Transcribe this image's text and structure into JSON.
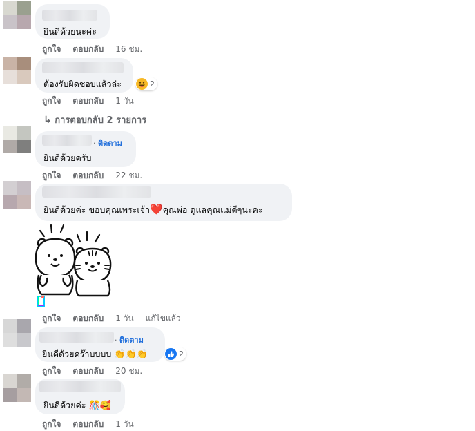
{
  "comments": [
    {
      "text": "ยินดีด้วยนะค่ะ",
      "like": "ถูกใจ",
      "reply": "ตอบกลับ",
      "time": "16 ชม.",
      "avatar_colors": [
        "#d8d8d0",
        "#9aa08f",
        "#c9c3c8",
        "#b8a8ae"
      ]
    },
    {
      "text": "ต้องรับผิดชอบแล้วล่ะ",
      "like": "ถูกใจ",
      "reply": "ตอบกลับ",
      "time": "1 วัน",
      "reaction_icon": "haha-icon",
      "reaction_count": "2",
      "replies_link": "การตอบกลับ 2 รายการ",
      "avatar_colors": [
        "#c9b3a6",
        "#a88e7c",
        "#e7dfda",
        "#d9c9bd"
      ]
    },
    {
      "text": "ยินดีด้วยครับ",
      "follow": "ติดตาม",
      "like": "ถูกใจ",
      "reply": "ตอบกลับ",
      "time": "22 ชม.",
      "avatar_colors": [
        "#e9e9e3",
        "#c4c6c0",
        "#b0aaa7",
        "#7f7f7e"
      ]
    },
    {
      "text_before": "ยินดีด้วยค่ะ ขอบคุณเพระเจ้า",
      "text_heart": "❤️",
      "text_after": "คุณพ่อ ดูแลคุณแม่ดีๆนะคะ",
      "like": "ถูกใจ",
      "reply": "ตอบกลับ",
      "time": "1 วัน",
      "edited": "แก้ไขแล้ว",
      "sticker": "bear-and-tiger-sticker",
      "avatar_colors": [
        "#d3cfd2",
        "#c6bec4",
        "#b7a8ae",
        "#c9b8b6"
      ]
    },
    {
      "text": "ยินดีด้วยคร๊าบบบบ",
      "emojis": "👏👏👏",
      "follow": "ติดตาม",
      "like": "ถูกใจ",
      "reply": "ตอบกลับ",
      "time": "20 ชม.",
      "reaction_icon": "like-icon",
      "reaction_count": "2",
      "avatar_colors": [
        "#d7d7d7",
        "#a9a7ad",
        "#dedede",
        "#c8c8cc"
      ]
    },
    {
      "text": "ยินดีด้วยค่ะ",
      "emojis": "🎊🥰",
      "like": "ถูกใจ",
      "reply": "ตอบกลับ",
      "time": "1 วัน",
      "avatar_colors": [
        "#d9d6d2",
        "#b1aca8",
        "#a69ea0",
        "#c3b8b4"
      ]
    }
  ],
  "colors": {
    "bubble": "#f0f2f5",
    "follow": "#216fdb",
    "meta": "#65676b",
    "heart": "#e41e3f",
    "like_blue": "#1877f2",
    "haha_yellow": "#f7b928"
  }
}
